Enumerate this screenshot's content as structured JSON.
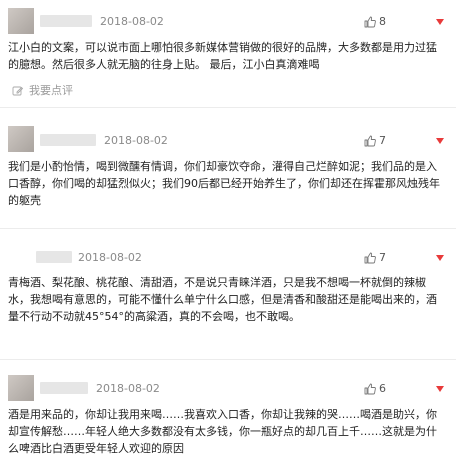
{
  "reply_label": "我要点评",
  "colors": {
    "accent": "#e83a3a",
    "meta": "#8a8a8a",
    "text": "#222222"
  },
  "icons": {
    "like": "thumbs-up-icon",
    "reply": "comment-edit-icon",
    "menu": "dropdown-arrow-icon"
  },
  "comments": [
    {
      "date": "2018-08-02",
      "likes": "8",
      "text": "江小白的文案，可以说市面上哪怕很多新媒体营销做的很好的品牌，大多数都是用力过猛的臆想。然后很多人就无脑的往身上贴。 最后，江小白真滴难喝"
    },
    {
      "date": "2018-08-02",
      "likes": "7",
      "text": "我们是小酌怡情，喝到微醺有情调，你们却豪饮夺命，灌得自己烂醉如泥；我们品的是入口香醇，你们喝的却猛烈似火；我们90后都已经开始养生了，你们却还在挥霍那风烛残年的躯壳"
    },
    {
      "date": "2018-08-02",
      "likes": "7",
      "text": "青梅酒、梨花酿、桃花酿、清甜酒，不是说只青睐洋酒，只是我不想喝一杯就倒的辣椒水，我想喝有意思的，可能不懂什么单宁什么口感，但是清香和酸甜还是能喝出来的，酒量不行动不动就45°54°的高粱酒，真的不会喝，也不敢喝。"
    },
    {
      "date": "2018-08-02",
      "likes": "6",
      "text": "酒是用来品的，你却让我用来喝……我喜欢入口香，你却让我辣的哭……喝酒是助兴，你却宣传解愁……年轻人绝大多数都没有太多钱，你一瓶好点的却几百上千……这就是为什么啤酒比白酒更受年轻人欢迎的原因"
    }
  ]
}
